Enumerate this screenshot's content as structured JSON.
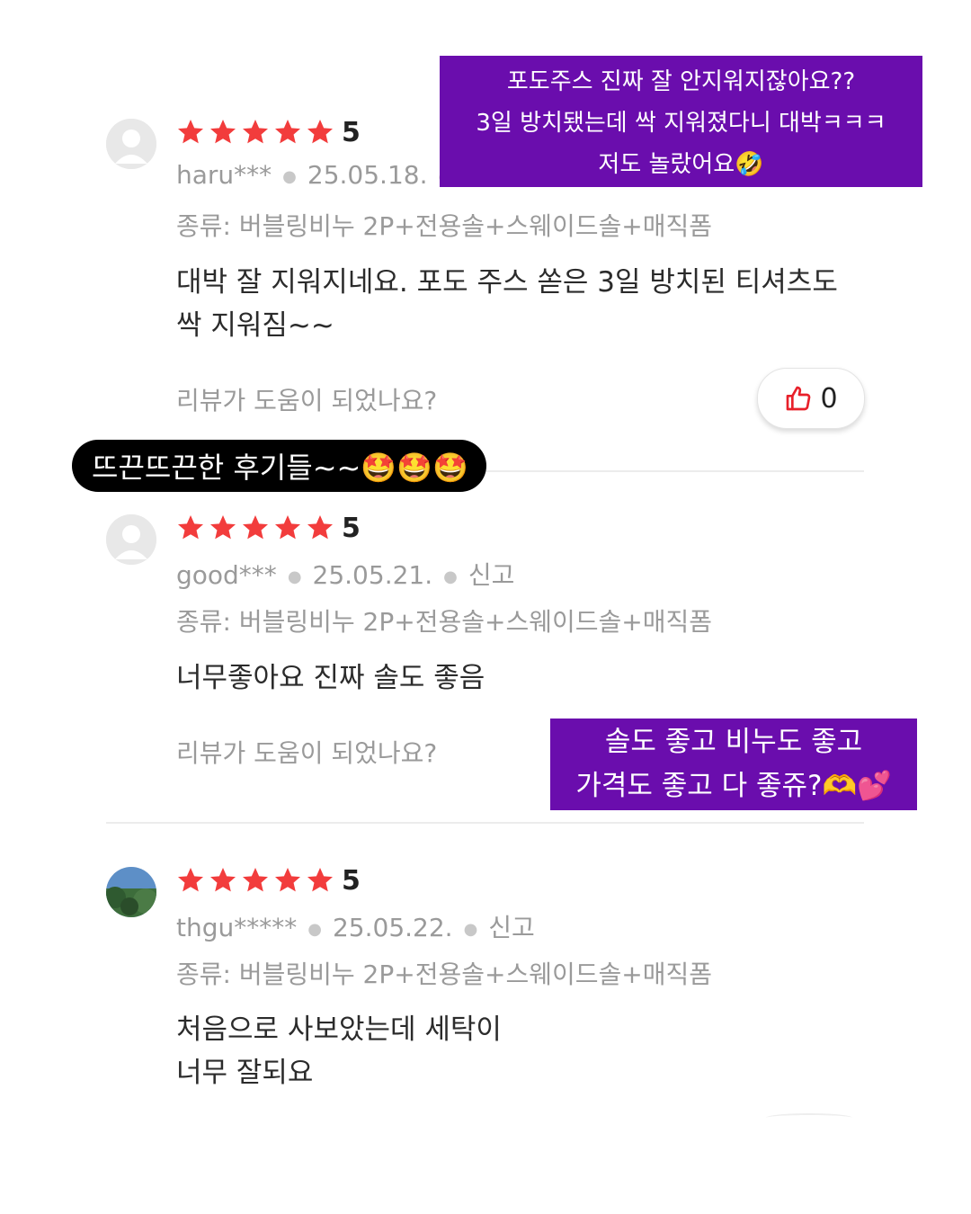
{
  "overlays": {
    "top_caption": {
      "lines": [
        "포도주스 진짜 잘 안지워지잖아요??",
        "3일 방치됐는데 싹 지워졌다니 대박ㅋㅋㅋ",
        "저도 놀랐어요🤣"
      ]
    },
    "middle_caption": {
      "text": "뜨끈뜨끈한 후기들~~🤩🤩🤩"
    },
    "bottom_caption": {
      "lines": [
        "솔도 좋고 비누도 좋고",
        "가격도 좋고 다 좋쥬?🫶💕"
      ]
    }
  },
  "helpful_prompt": "리뷰가 도움이 되었나요?",
  "colors": {
    "star": "#f23c3c",
    "caption_purple": "#6a0dad",
    "caption_black": "#000000"
  },
  "reviews": [
    {
      "rating": 5,
      "score": "5",
      "user": "haru***",
      "date": "25.05.18.",
      "report": "",
      "option": "종류: 버블링비누 2P+전용솔+스웨이드솔+매직폼",
      "body_lines": [
        "대박 잘 지워지네요. 포도 주스 쏟은 3일 방치된 티셔츠도",
        "싹 지워짐~~"
      ],
      "helpful_count": "0",
      "avatar": "default-avatar-icon"
    },
    {
      "rating": 5,
      "score": "5",
      "user": "good***",
      "date": "25.05.21.",
      "report": "신고",
      "option": "종류: 버블링비누 2P+전용솔+스웨이드솔+매직폼",
      "body_lines": [
        "너무좋아요 진짜  솔도 좋음"
      ],
      "avatar": "default-avatar-icon"
    },
    {
      "rating": 5,
      "score": "5",
      "user": "thgu*****",
      "date": "25.05.22.",
      "report": "신고",
      "option": "종류: 버블링비누 2P+전용솔+스웨이드솔+매직폼",
      "body_lines": [
        "처음으로 사보았는데 세탁이",
        "너무 잘되요"
      ],
      "avatar": "photo-avatar-icon"
    }
  ]
}
